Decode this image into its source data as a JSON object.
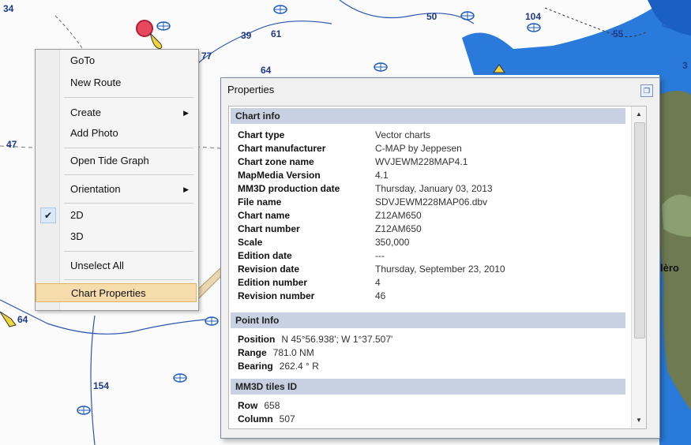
{
  "map": {
    "depths": [
      "34",
      "77",
      "39",
      "61",
      "50",
      "104",
      "55",
      "3",
      "47",
      "64",
      "64",
      "154"
    ],
    "label_fragment": "lèro"
  },
  "context_menu": {
    "items": [
      {
        "label": "GoTo"
      },
      {
        "label": "New Route"
      },
      {
        "label": "Create",
        "submenu": true
      },
      {
        "label": "Add Photo"
      },
      {
        "label": "Open Tide Graph"
      },
      {
        "label": "Orientation",
        "submenu": true
      },
      {
        "label": "2D",
        "checked": true
      },
      {
        "label": "3D"
      },
      {
        "label": "Unselect All"
      },
      {
        "label": "Chart Properties",
        "highlighted": true
      }
    ]
  },
  "properties": {
    "title": "Properties",
    "sections": {
      "chart_info": {
        "header": "Chart info",
        "rows": [
          {
            "key": "Chart type",
            "value": "Vector charts"
          },
          {
            "key": "Chart manufacturer",
            "value": "C-MAP by Jeppesen"
          },
          {
            "key": "Chart zone name",
            "value": "WVJEWM228MAP4.1"
          },
          {
            "key": "MapMedia Version",
            "value": "4.1"
          },
          {
            "key": "MM3D production date",
            "value": "Thursday, January 03, 2013"
          },
          {
            "key": "File name",
            "value": "SDVJEWM228MAP06.dbv"
          },
          {
            "key": "Chart name",
            "value": "Z12AM650"
          },
          {
            "key": "Chart number",
            "value": "Z12AM650"
          },
          {
            "key": "Scale",
            "value": "350,000"
          },
          {
            "key": "Edition date",
            "value": "---"
          },
          {
            "key": "Revision date",
            "value": "Thursday, September 23, 2010"
          },
          {
            "key": "Edition number",
            "value": "4"
          },
          {
            "key": "Revision number",
            "value": "46"
          }
        ]
      },
      "point_info": {
        "header": "Point Info",
        "rows": [
          {
            "key": "Position",
            "value": "N 45°56.938'; W 1°37.507'"
          },
          {
            "key": "Range",
            "value": "781.0 NM"
          },
          {
            "key": "Bearing",
            "value": "262.4 ° R"
          }
        ]
      },
      "tiles": {
        "header": "MM3D tiles ID",
        "rows": [
          {
            "key": "Row",
            "value": "658"
          },
          {
            "key": "Column",
            "value": "507"
          }
        ]
      }
    }
  },
  "icons": {
    "check": "✔",
    "submenu_arrow": "▶",
    "scroll_up": "▲",
    "scroll_down": "▼",
    "maximize": "❐"
  },
  "colors": {
    "map_water": "#fbfbfb",
    "shallow_blue": "#1e73d8",
    "section_header": "#c7d1e2",
    "menu_highlight": "#f6dcab",
    "depth_text": "#1f3a88"
  }
}
